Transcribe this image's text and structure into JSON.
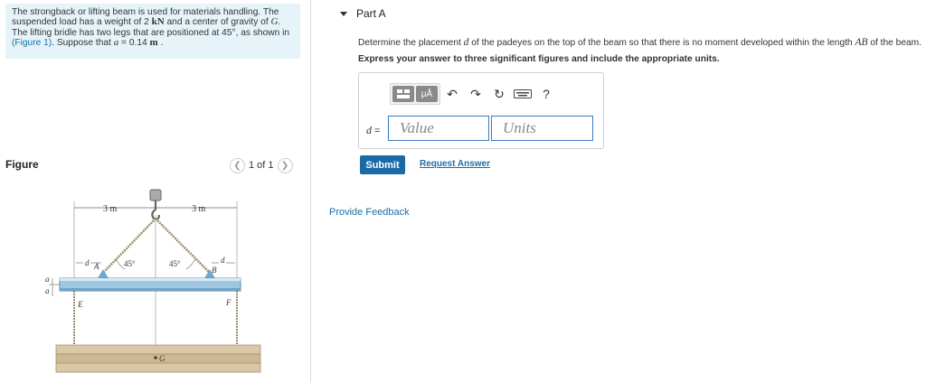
{
  "problem": {
    "line1": "The strongback or lifting beam is used for materials handling. The",
    "line2_pre": "suspended load has a weight of 2 ",
    "line2_unit": "kN",
    "line2_mid": " and a center of gravity of ",
    "line2_var": "G",
    "line2_post": ".",
    "line3": "The lifting bridle has two legs that are positioned at 45°, as shown in",
    "line4_link": "(Figure 1)",
    "line4_mid": ". Suppose that ",
    "line4_var": "a",
    "line4_eq": " = 0.14 ",
    "line4_unit": "m",
    "line4_post": " ."
  },
  "figure": {
    "title": "Figure",
    "pager": "1 of 1",
    "prev_icon": "chevron-left-icon",
    "next_icon": "chevron-right-icon",
    "labels": {
      "dim_left": "3 m",
      "dim_right": "3 m",
      "angle_left": "45°",
      "angle_right": "45°",
      "point_a": "A",
      "point_b": "B",
      "point_e": "E",
      "point_f": "F",
      "point_g": "G",
      "d_left": "d",
      "d_right": "d",
      "a_top": "a",
      "a_bottom": "a"
    }
  },
  "part": {
    "label": "Part A",
    "question_pre": "Determine the placement ",
    "question_var": "d",
    "question_mid": " of the padeyes on the top of the beam so that there is no moment developed within the length ",
    "question_var2": "AB",
    "question_post": " of the beam.",
    "instruction": "Express your answer to three significant figures and include the appropriate units."
  },
  "answer": {
    "var": "d",
    "equals": " =",
    "value_placeholder": "Value",
    "units_placeholder": "Units",
    "toolbar": {
      "template_icon": "template-icon",
      "units_label": "μÅ",
      "undo_icon": "undo-icon",
      "redo_icon": "redo-icon",
      "reset_icon": "reset-icon",
      "keyboard_icon": "keyboard-icon",
      "help_label": "?"
    }
  },
  "actions": {
    "submit": "Submit",
    "request": "Request Answer",
    "feedback": "Provide Feedback"
  }
}
